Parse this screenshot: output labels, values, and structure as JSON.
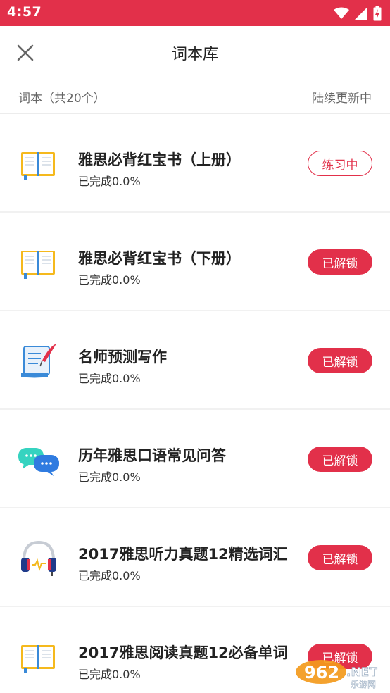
{
  "status_bar": {
    "time": "4:57",
    "background": "#e2304a"
  },
  "header": {
    "title": "词本库",
    "close_icon": "close-icon"
  },
  "subheader": {
    "count_label": "词本（共20个）",
    "more_label": "陆续更新中"
  },
  "accent_color": "#e2304a",
  "books": [
    {
      "title": "雅思必背红宝书（上册）",
      "progress": "已完成0.0%",
      "button": "练习中",
      "icon": "open-book-icon"
    },
    {
      "title": "雅思必背红宝书（下册）",
      "progress": "已完成0.0%",
      "button": "已解锁",
      "icon": "open-book-icon"
    },
    {
      "title": "名师预测写作",
      "progress": "已完成0.0%",
      "button": "已解锁",
      "icon": "quill-document-icon"
    },
    {
      "title": "历年雅思口语常见问答",
      "progress": "已完成0.0%",
      "button": "已解锁",
      "icon": "chat-bubbles-icon"
    },
    {
      "title": "2017雅思听力真题12精选词汇",
      "progress": "已完成0.0%",
      "button": "已解锁",
      "icon": "headphones-icon"
    },
    {
      "title": "2017雅思阅读真题12必备单词",
      "progress": "已完成0.0%",
      "button": "已解锁",
      "icon": "open-book-icon"
    }
  ],
  "watermark": {
    "number": "962",
    "tld": ".NET",
    "caption": "乐游网"
  }
}
